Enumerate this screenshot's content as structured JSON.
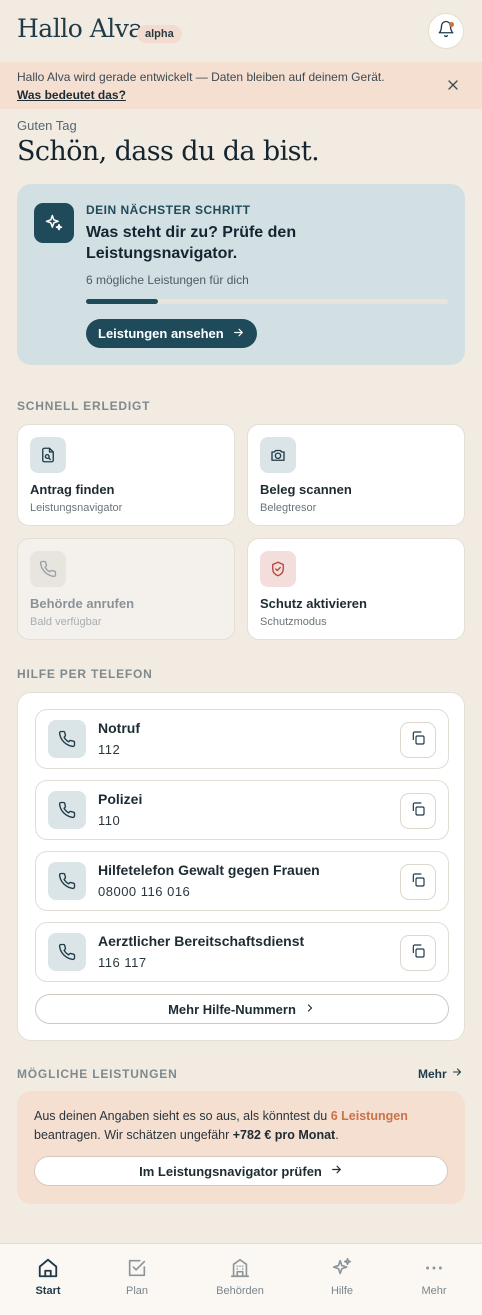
{
  "header": {
    "title": "Hallo Alva",
    "badge": "alpha",
    "notifications_icon": "bell-icon",
    "accent": "#c9734a"
  },
  "banner": {
    "text": "Hallo Alva wird gerade entwickelt — Daten bleiben auf deinem Gerät.",
    "link": "Was bedeutet das?",
    "close_icon": "close-icon"
  },
  "greeting": {
    "sub": "Guten Tag",
    "main": "Schön, dass du da bist."
  },
  "next_step": {
    "kicker": "DEIN NÄCHSTER SCHRITT",
    "title": "Was steht dir zu? Prüfe den Leistungsnavigator.",
    "meta": "6 mögliche Leistungen für dich",
    "progress": 0.2,
    "button": "Leistungen ansehen",
    "icon": "sparkles-icon",
    "color": "#1f4a5a"
  },
  "quick": {
    "title": "SCHNELL ERLEDIGT",
    "tiles": [
      {
        "title": "Antrag finden",
        "sub": "Leistungsnavigator",
        "icon": "document-search-icon",
        "enabled": true
      },
      {
        "title": "Beleg scannen",
        "sub": "Belegtresor",
        "icon": "camera-icon",
        "enabled": true
      },
      {
        "title": "Behörde anrufen",
        "sub": "Bald verfügbar",
        "icon": "phone-icon",
        "enabled": false
      },
      {
        "title": "Schutz aktivieren",
        "sub": "Schutzmodus",
        "icon": "shield-icon",
        "enabled": true
      }
    ]
  },
  "phone": {
    "title": "HILFE PER TELEFON",
    "rows": [
      {
        "name": "Notruf",
        "number": "112"
      },
      {
        "name": "Polizei",
        "number": "110"
      },
      {
        "name": "Hilfetelefon Gewalt gegen Frauen",
        "number": "08000 116 016"
      },
      {
        "name": "Aerztlicher Bereitschaftsdienst",
        "number": "116 117"
      }
    ],
    "more_button": "Mehr Hilfe-Nummern"
  },
  "benefits": {
    "title": "MÖGLICHE LEISTUNGEN",
    "more_link": "Mehr",
    "text_before": "Aus deinen Angaben sieht es so aus, als könntest du ",
    "count_text": "6 Leistungen",
    "text_middle": " beantragen. Wir schätzen ungefähr ",
    "amount": "+782 € pro Monat",
    "text_after": ".",
    "button": "Im Leistungsnavigator prüfen"
  },
  "nav": {
    "items": [
      {
        "label": "Start",
        "icon": "home-icon",
        "active": true
      },
      {
        "label": "Plan",
        "icon": "checkbox-icon",
        "active": false
      },
      {
        "label": "Behörden",
        "icon": "building-icon",
        "active": false
      },
      {
        "label": "Hilfe",
        "icon": "sparkles-icon",
        "active": false
      },
      {
        "label": "Mehr",
        "icon": "more-dots-icon",
        "active": false
      }
    ]
  }
}
